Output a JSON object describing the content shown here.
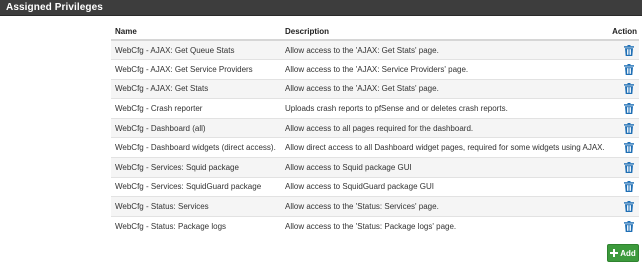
{
  "panel": {
    "title": "Assigned Privileges"
  },
  "table": {
    "headers": {
      "name": "Name",
      "description": "Description",
      "action": "Action"
    },
    "rows": [
      {
        "name": "WebCfg - AJAX: Get Queue Stats",
        "description": "Allow access to the 'AJAX: Get Stats' page."
      },
      {
        "name": "WebCfg - AJAX: Get Service Providers",
        "description": "Allow access to the 'AJAX: Service Providers' page."
      },
      {
        "name": "WebCfg - AJAX: Get Stats",
        "description": "Allow access to the 'AJAX: Get Stats' page."
      },
      {
        "name": "WebCfg - Crash reporter",
        "description": "Uploads crash reports to pfSense and or deletes crash reports."
      },
      {
        "name": "WebCfg - Dashboard (all)",
        "description": "Allow access to all pages required for the dashboard."
      },
      {
        "name": "WebCfg - Dashboard widgets (direct access).",
        "description": "Allow direct access to all Dashboard widget pages, required for some widgets using AJAX."
      },
      {
        "name": "WebCfg - Services: Squid package",
        "description": "Allow access to Squid package GUI"
      },
      {
        "name": "WebCfg - Services: SquidGuard package",
        "description": "Allow access to SquidGuard package GUI"
      },
      {
        "name": "WebCfg - Status: Services",
        "description": "Allow access to the 'Status: Services' page."
      },
      {
        "name": "WebCfg - Status: Package logs",
        "description": "Allow access to the 'Status: Package logs' page."
      }
    ],
    "row_action_icon": "trash-icon"
  },
  "add_button": {
    "label": "Add",
    "icon": "plus-icon"
  },
  "colors": {
    "header_bar": "#3d3d3d",
    "trash": "#1f6fb5",
    "add_button": "#3c9a3c"
  }
}
